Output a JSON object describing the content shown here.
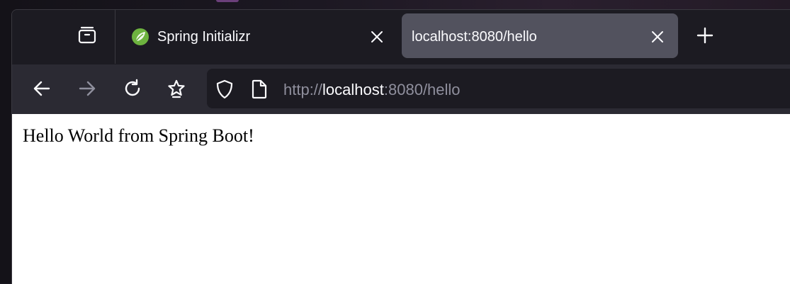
{
  "tabs": [
    {
      "title": "Spring Initializr",
      "favicon": "spring-leaf-icon",
      "active": false
    },
    {
      "title": "localhost:8080/hello",
      "active": true
    }
  ],
  "toolbar": {
    "tab_group_icon": "tab-manager-icon",
    "new_tab_icon": "plus-icon",
    "close_icon": "close-icon"
  },
  "navigation": {
    "back_icon": "arrow-left-icon",
    "forward_icon": "arrow-right-icon",
    "reload_icon": "reload-icon",
    "bookmark_icon": "star-icon"
  },
  "urlbar": {
    "scheme": "http://",
    "host": "localhost",
    "rest": ":8080/hello",
    "security_icon": "shield-icon",
    "page_icon": "page-icon"
  },
  "page": {
    "body_text": "Hello World from Spring Boot!"
  },
  "colors": {
    "tabstrip_bg": "#1c1b22",
    "navbar_bg": "#2b2a33",
    "active_tab_bg": "#52525e",
    "spring_green": "#6db33f",
    "text_light": "#fbfbfe",
    "text_muted": "#8f8f9d"
  }
}
